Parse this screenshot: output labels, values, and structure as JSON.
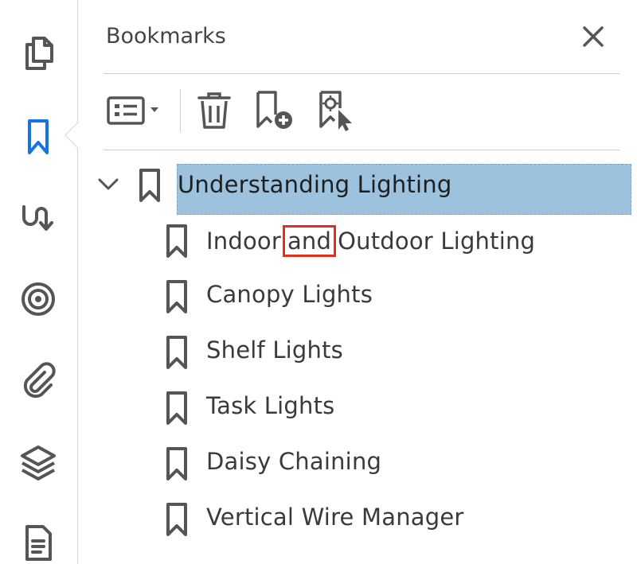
{
  "panel": {
    "title": "Bookmarks",
    "close_icon": "close-icon"
  },
  "rail": {
    "items": [
      {
        "icon": "pages-icon",
        "active": false
      },
      {
        "icon": "bookmark-icon",
        "active": true
      },
      {
        "icon": "signature-icon",
        "active": false
      },
      {
        "icon": "target-icon",
        "active": false
      },
      {
        "icon": "attachment-icon",
        "active": false
      },
      {
        "icon": "layers-icon",
        "active": false
      },
      {
        "icon": "document-icon",
        "active": false
      }
    ],
    "active_color": "#1473e6"
  },
  "toolbar": {
    "options_icon": "options-list-icon",
    "delete_icon": "trash-icon",
    "add_icon": "add-bookmark-icon",
    "new_from_selection_icon": "bookmark-target-icon"
  },
  "tree": {
    "root": {
      "label": "Understanding Lighting",
      "expanded": true,
      "selected": true
    },
    "children": [
      {
        "label_before": "Indoor",
        "label_highlight": "and",
        "label_after": "Outdoor Lighting"
      },
      {
        "label": "Canopy Lights"
      },
      {
        "label": "Shelf Lights"
      },
      {
        "label": "Task Lights"
      },
      {
        "label": "Daisy Chaining"
      },
      {
        "label": "Vertical Wire Manager"
      }
    ]
  },
  "colors": {
    "selection": "#9cc2dd",
    "highlight_box": "#e0301e",
    "icon_gray": "#5a5a5a"
  }
}
